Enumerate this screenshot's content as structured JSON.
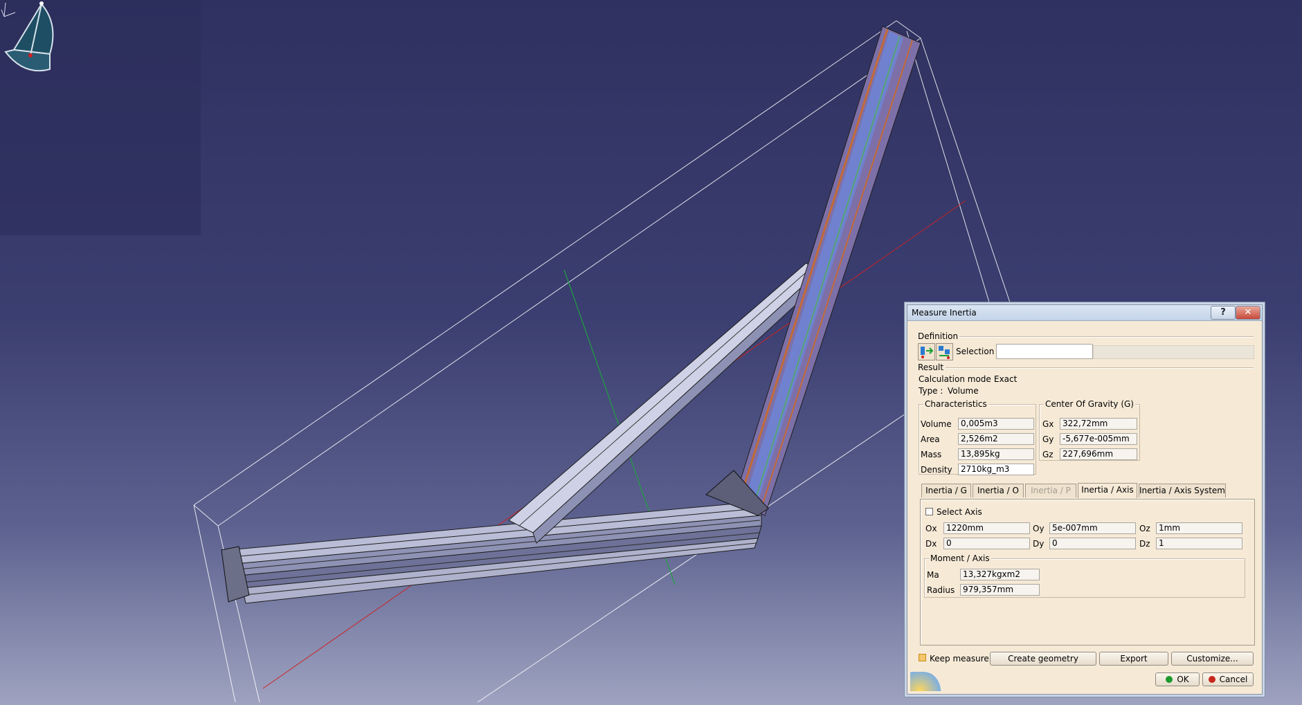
{
  "dialog": {
    "title": "Measure Inertia",
    "help_label": "?",
    "close_label": "✕",
    "definition_label": "Definition",
    "selection_label": "Selection",
    "selection_value": "",
    "result_label": "Result",
    "calc_mode_label": "Calculation mode :",
    "calc_mode_value": "Exact",
    "type_label": "Type :",
    "type_value": "Volume",
    "characteristics": {
      "caption": "Characteristics",
      "rows": [
        {
          "label": "Volume",
          "value": "0,005m3"
        },
        {
          "label": "Area",
          "value": "2,526m2"
        },
        {
          "label": "Mass",
          "value": "13,895kg"
        },
        {
          "label": "Density",
          "value": "2710kg_m3"
        }
      ]
    },
    "cog": {
      "caption": "Center Of Gravity (G)",
      "rows": [
        {
          "label": "Gx",
          "value": "322,72mm"
        },
        {
          "label": "Gy",
          "value": "-5,677e-005mm"
        },
        {
          "label": "Gz",
          "value": "227,696mm"
        }
      ]
    },
    "tabs": [
      "Inertia / G",
      "Inertia / O",
      "Inertia / P",
      "Inertia / Axis",
      "Inertia / Axis System"
    ],
    "select_axis_label": "Select Axis",
    "axis_origin": [
      {
        "label": "Ox",
        "value": "1220mm"
      },
      {
        "label": "Oy",
        "value": "5e-007mm"
      },
      {
        "label": "Oz",
        "value": "1mm"
      }
    ],
    "axis_dir": [
      {
        "label": "Dx",
        "value": "0"
      },
      {
        "label": "Dy",
        "value": "0"
      },
      {
        "label": "Dz",
        "value": "1"
      }
    ],
    "moment": {
      "caption": "Moment / Axis",
      "rows": [
        {
          "label": "Ma",
          "value": "13,327kgxm2"
        },
        {
          "label": "Radius",
          "value": "979,357mm"
        }
      ]
    },
    "keep_measure_label": "Keep measure",
    "buttons": {
      "create_geometry": "Create geometry",
      "export": "Export",
      "customize": "Customize...",
      "ok": "OK",
      "cancel": "Cancel"
    }
  },
  "colors": {
    "background_top": "#2f3160",
    "background_bottom": "#9fa3c0",
    "dialog_bg": "#f6ead7",
    "ok_green": "#1e9a2c",
    "cancel_red": "#c8261c"
  }
}
